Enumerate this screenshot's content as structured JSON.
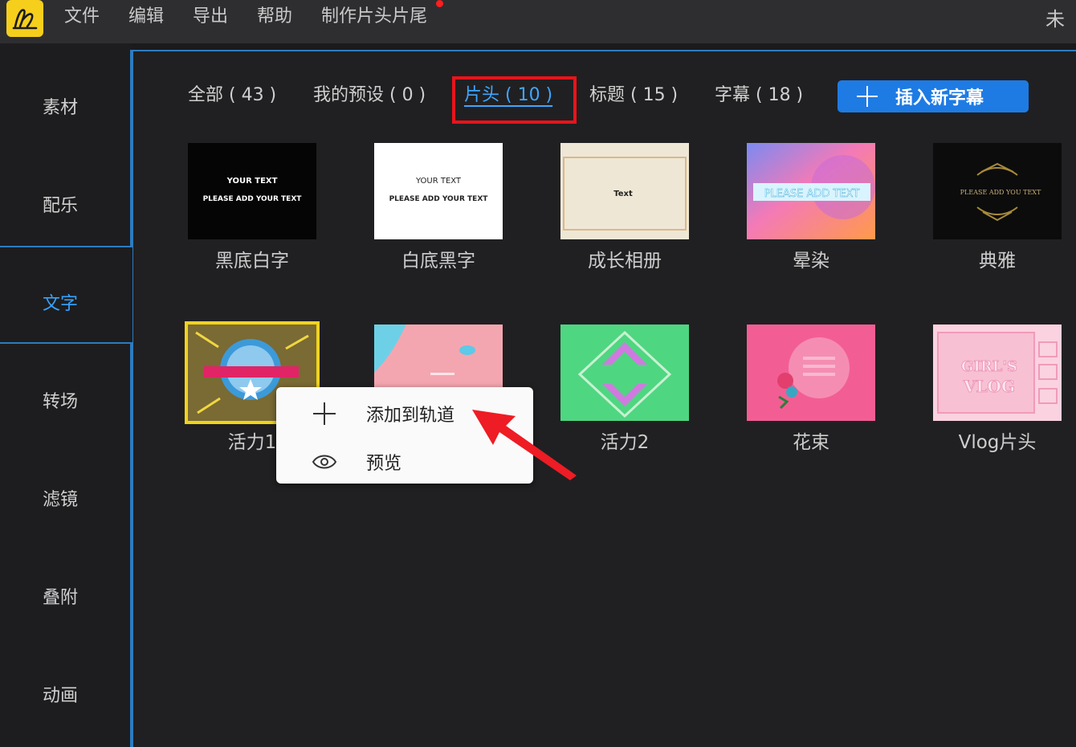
{
  "menubar": {
    "items": [
      "文件",
      "编辑",
      "导出",
      "帮助",
      "制作片头片尾"
    ],
    "right_title": "未"
  },
  "sidebar": {
    "items": [
      {
        "label": "素材",
        "active": false
      },
      {
        "label": "配乐",
        "active": false
      },
      {
        "label": "文字",
        "active": true
      },
      {
        "label": "转场",
        "active": false
      },
      {
        "label": "滤镜",
        "active": false
      },
      {
        "label": "叠附",
        "active": false
      },
      {
        "label": "动画",
        "active": false
      }
    ]
  },
  "tabs": [
    {
      "label": "全部 ( 43 )",
      "active": false
    },
    {
      "label": "我的预设 ( 0 )",
      "active": false
    },
    {
      "label": "片头 ( 10 )",
      "active": true
    },
    {
      "label": "标题 ( 15 )",
      "active": false
    },
    {
      "label": "字幕 ( 18 )",
      "active": false
    }
  ],
  "insert_button": {
    "label": "插入新字幕"
  },
  "templates": [
    {
      "name": "黑底白字",
      "thumb_text": [
        "YOUR TEXT",
        "PLEASE ADD YOUR TEXT"
      ]
    },
    {
      "name": "白底黑字",
      "thumb_text": [
        "YOUR TEXT",
        "PLEASE ADD YOUR TEXT"
      ]
    },
    {
      "name": "成长相册",
      "thumb_text": [
        "Text"
      ]
    },
    {
      "name": "晕染",
      "thumb_text": [
        "PLEASE ADD TEXT"
      ]
    },
    {
      "name": "典雅",
      "thumb_text": [
        "PLEASE ADD YOU TEXT"
      ]
    },
    {
      "name": "活力1",
      "thumb_text": []
    },
    {
      "name": "",
      "thumb_text": []
    },
    {
      "name": "活力2",
      "thumb_text": []
    },
    {
      "name": "花束",
      "thumb_text": []
    },
    {
      "name": "Vlog片头",
      "thumb_text": [
        "GIRL'S",
        "VLOG"
      ]
    }
  ],
  "context_menu": {
    "add_label": "添加到轨道",
    "preview_label": "预览"
  },
  "colors": {
    "accent": "#1e7be4",
    "active_text": "#3ea6ff",
    "highlight": "#e8141b",
    "selected_border": "#f1d31e"
  }
}
